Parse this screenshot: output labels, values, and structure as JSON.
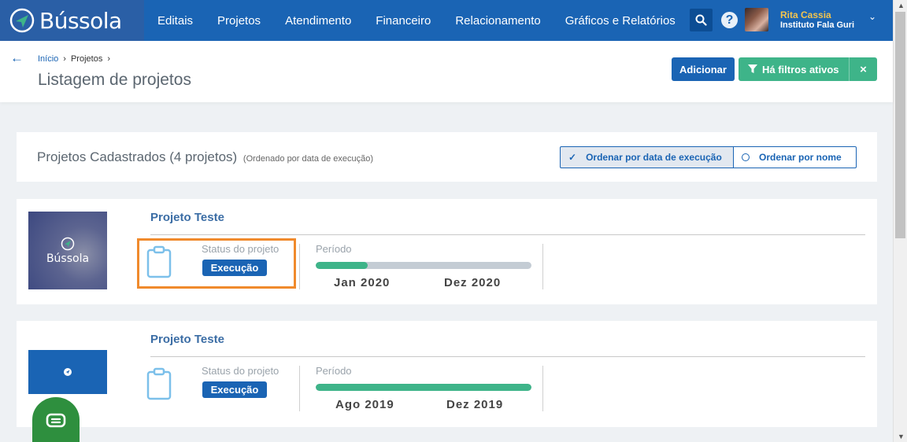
{
  "app": {
    "logo_text": "Bússola"
  },
  "nav": [
    "Editais",
    "Projetos",
    "Atendimento",
    "Financeiro",
    "Relacionamento",
    "Gráficos e Relatórios"
  ],
  "user": {
    "name": "Rita Cassia",
    "org": "Instituto Fala Guri"
  },
  "breadcrumb": {
    "home": "Início",
    "current": "Projetos"
  },
  "page": {
    "title": "Listagem de projetos"
  },
  "actions": {
    "add_label": "Adicionar",
    "filter_label": "Há filtros ativos",
    "clear_filter": "×"
  },
  "projects_bar": {
    "title": "Projetos Cadastrados (4 projetos)",
    "subtitle": "(Ordenado por data de execução)",
    "sort_by_date": "Ordenar por data de execução",
    "sort_by_name": "Ordenar por nome"
  },
  "projects": [
    {
      "title": "Projeto Teste",
      "thumb_text": "Bússola",
      "status_label": "Status do projeto",
      "status": "Execução",
      "period_label": "Período",
      "start": "Jan 2020",
      "end": "Dez 2020",
      "progress": 0.24
    },
    {
      "title": "Projeto Teste",
      "status_label": "Status do projeto",
      "status": "Execução",
      "period_label": "Período",
      "start": "Ago 2019",
      "end": "Dez 2019",
      "progress": 1.0
    }
  ],
  "colors": {
    "primary": "#1a64b4",
    "success": "#3eb489",
    "highlight": "#f08a2c",
    "chat": "#2e8f3e"
  },
  "icons": [
    "compass-icon",
    "search-icon",
    "help-icon",
    "chevron-down-icon",
    "back-arrow-icon",
    "filter-icon",
    "check-icon",
    "clipboard-icon",
    "chat-icon"
  ]
}
